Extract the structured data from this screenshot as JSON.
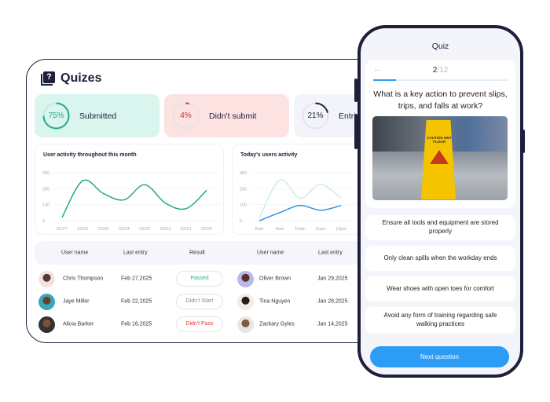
{
  "dashboard": {
    "title": "Quizes",
    "title_icon": "question-book-icon",
    "stats": [
      {
        "value": "75%",
        "label": "Submitted",
        "percent": 75,
        "color": "#22a98a",
        "bg": "#d9f5ee"
      },
      {
        "value": "4%",
        "label": "Didn't submit",
        "percent": 4,
        "color": "#c0353f",
        "bg": "#fde2e2"
      },
      {
        "value": "21%",
        "label": "Entri",
        "percent": 21,
        "color": "#1e1f3b",
        "bg": "#f3f4fa"
      }
    ]
  },
  "chart_data": [
    {
      "type": "line",
      "title": "User activity throughout this month",
      "categories": [
        "02/27",
        "02/26",
        "02/25",
        "02/24",
        "02/23",
        "02/22",
        "02/21",
        "02/20"
      ],
      "yticks": [
        "300",
        "200",
        "100",
        "0"
      ],
      "ylim": [
        0,
        300
      ],
      "series": [
        {
          "values": [
            20,
            250,
            170,
            130,
            225,
            110,
            75,
            190
          ],
          "color": "#22a98a"
        }
      ]
    },
    {
      "type": "line",
      "title": "Today's users activity",
      "categories": [
        "8am",
        "9am",
        "10am",
        "11am",
        "12pm"
      ],
      "yticks": [
        "300",
        "200",
        "100",
        "0"
      ],
      "ylim": [
        0,
        300
      ],
      "series": [
        {
          "values": [
            15,
            255,
            140,
            228,
            140
          ],
          "color": "#cdeee5"
        },
        {
          "values": [
            0,
            50,
            95,
            65,
            95
          ],
          "color": "#3a8fe0"
        }
      ]
    }
  ],
  "table": {
    "headers": [
      "User name",
      "Last entry",
      "Result",
      "User name",
      "Last entry"
    ],
    "rows": [
      {
        "name": "Chris Thompson",
        "date": "Feb 27,2025",
        "result": "Passed",
        "result_color": "#22b08f",
        "name2": "Oliver Brown",
        "date2": "Jan 29,2025"
      },
      {
        "name": "Jaye Miller",
        "date": "Feb 22,2025",
        "result": "Didn't Start",
        "result_color": "#888",
        "name2": "Tina Nguyen",
        "date2": "Jan 28,2025"
      },
      {
        "name": "Alicia Barker",
        "date": "Feb 16,2025",
        "result": "Didn't Pass",
        "result_color": "#e0383e",
        "name2": "Zackary Gyles",
        "date2": "Jan 14,2025"
      }
    ]
  },
  "quiz": {
    "title": "Quiz",
    "current": "2",
    "total": "/12",
    "progress": 0.167,
    "question": "What is a key action to prevent slips, trips, and falls at work?",
    "sign_text": "CAUTION WET FLOOR",
    "options": [
      "Ensure all tools and equipment are stored properly",
      "Only clean spills when the workday ends",
      "Wear shoes with open toes for comfort",
      "Avoid any form of training regarding safe walking practices"
    ],
    "next_label": "Next question"
  }
}
